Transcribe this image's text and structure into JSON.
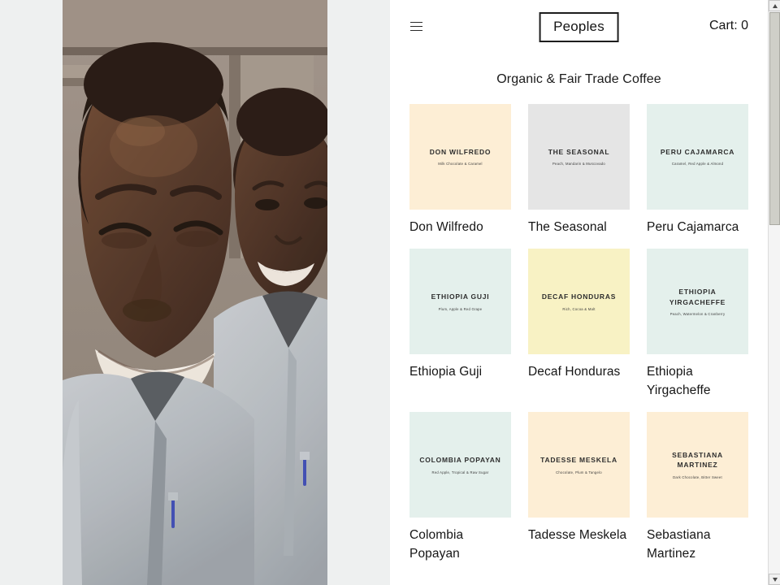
{
  "header": {
    "menu_icon": "hamburger-menu-icon",
    "brand": "Peoples",
    "cart_label": "Cart: 0"
  },
  "main": {
    "heading": "Organic & Fair Trade Coffee"
  },
  "colors": {
    "bag_cream": "#fdeed5",
    "bag_gray": "#e5e5e5",
    "bag_mint": "#e4f0ec",
    "bag_yellow": "#f8f2c4",
    "page_background": "#eef0f0",
    "panel_background": "#ffffff",
    "text": "#161616"
  },
  "products": [
    {
      "bag_title": "DON WILFREDO",
      "notes": "Milk Chocolate & Caramel",
      "name": "Don Wilfredo",
      "bag_color": "#fdeed5"
    },
    {
      "bag_title": "THE SEASONAL",
      "notes": "Peach, Mandarin & Muscovado",
      "name": "The Seasonal",
      "bag_color": "#e5e5e5"
    },
    {
      "bag_title": "PERU CAJAMARCA",
      "notes": "Caramel, Red Apple & Almond",
      "name": "Peru Cajamarca",
      "bag_color": "#e4f0ec"
    },
    {
      "bag_title": "ETHIOPIA GUJI",
      "notes": "Plum, Apple & Red Grape",
      "name": "Ethiopia Guji",
      "bag_color": "#e4f0ec"
    },
    {
      "bag_title": "DECAF HONDURAS",
      "notes": "Rich, Cocoa & Malt",
      "name": "Decaf Honduras",
      "bag_color": "#f8f2c4"
    },
    {
      "bag_title": "ETHIOPIA YIRGACHEFFE",
      "notes": "Peach, Watermelon & Cranberry",
      "name": "Ethiopia Yirgacheffe",
      "bag_color": "#e4f0ec"
    },
    {
      "bag_title": "COLOMBIA POPAYAN",
      "notes": "Red Apple, Tropical & Raw Sugar",
      "name": "Colombia Popayan",
      "bag_color": "#e4f0ec"
    },
    {
      "bag_title": "TADESSE MESKELA",
      "notes": "Chocolate, Plum & Tangelo",
      "name": "Tadesse Meskela",
      "bag_color": "#fdeed5"
    },
    {
      "bag_title": "SEBASTIANA MARTINEZ",
      "notes": "Dark Chocolate, Bitter Sweet",
      "name": "Sebastiana Martinez",
      "bag_color": "#fdeed5"
    }
  ],
  "hero": {
    "alt": "Two smiling coffee farmers in light gray shirts"
  },
  "scrollbar": {
    "up_icon": "scroll-up-arrow-icon",
    "down_icon": "scroll-down-arrow-icon"
  }
}
